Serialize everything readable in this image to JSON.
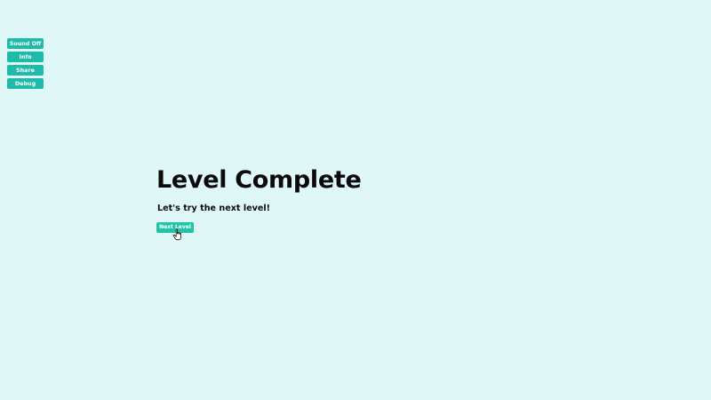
{
  "menu": {
    "sound_label": "Sound Off",
    "info_label": "Info",
    "share_label": "Share",
    "debug_label": "Debug"
  },
  "main": {
    "title": "Level Complete",
    "subtitle": "Let's try the next level!",
    "next_label": "Next Level"
  },
  "colors": {
    "background": "#e0f7f7",
    "button": "#1fbaa9",
    "button_text": "#ffffff",
    "title_text": "#0b0b0b"
  },
  "icons": {
    "cursor": "hand-pointer-icon"
  }
}
